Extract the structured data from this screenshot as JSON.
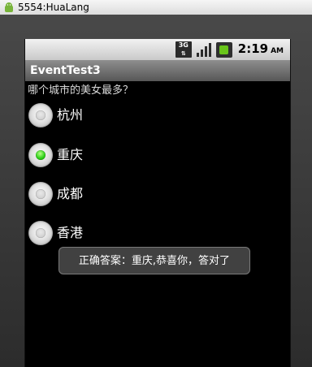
{
  "window": {
    "title": "5554:HuaLang"
  },
  "status_bar": {
    "network": "3G",
    "time": "2:19",
    "ampm": "AM"
  },
  "app": {
    "title": "EventTest3",
    "question": "哪个城市的美女最多？",
    "options": [
      {
        "label": "杭州",
        "checked": false
      },
      {
        "label": "重庆",
        "checked": true
      },
      {
        "label": "成都",
        "checked": false
      },
      {
        "label": "香港",
        "checked": false
      }
    ],
    "toast": "正确答案：重庆,恭喜你，答对了"
  },
  "colors": {
    "radio_checked": "#30d11a",
    "app_bar": "#6f6f6f",
    "toast_bg": "#444444"
  }
}
